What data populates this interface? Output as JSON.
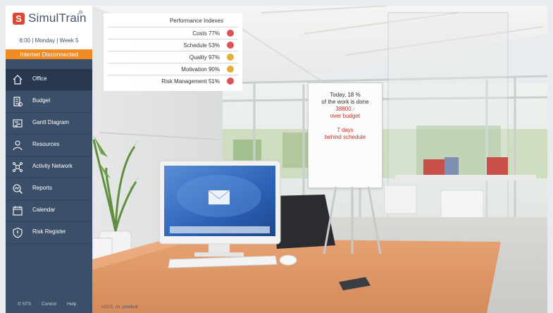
{
  "brand": {
    "logo_letter": "S",
    "name": "SimulTrain",
    "reg": "®",
    "accent": "#d94735"
  },
  "status": {
    "time_line": "8:00  |  Monday  |  Week 5",
    "network": "Internet Disconnected",
    "network_color": "#f08a23"
  },
  "nav": [
    {
      "label": "Office",
      "icon": "office-icon",
      "active": true
    },
    {
      "label": "Budget",
      "icon": "budget-icon",
      "active": false
    },
    {
      "label": "Gantt Diagram",
      "icon": "gantt-icon",
      "active": false
    },
    {
      "label": "Resources",
      "icon": "resources-icon",
      "active": false
    },
    {
      "label": "Activity Network",
      "icon": "activity-network-icon",
      "active": false
    },
    {
      "label": "Reports",
      "icon": "reports-icon",
      "active": false
    },
    {
      "label": "Calendar",
      "icon": "calendar-icon",
      "active": false
    },
    {
      "label": "Risk Register",
      "icon": "risk-register-icon",
      "active": false
    }
  ],
  "footer": {
    "copyright": "© STS",
    "control": "Control",
    "help": "Help",
    "version": "v12.0, cn. product"
  },
  "performance": {
    "title": "Performance Indexes",
    "rows": [
      {
        "label": "Costs 77%",
        "status_color": "#dc5158"
      },
      {
        "label": "Schedule 53%",
        "status_color": "#dc5158"
      },
      {
        "label": "Quality 97%",
        "status_color": "#e5ae35"
      },
      {
        "label": "Motivation 90%",
        "status_color": "#e5ae35"
      },
      {
        "label": "Risk Management 51%",
        "status_color": "#dc5158"
      }
    ]
  },
  "flipchart": {
    "line1": "Today, 18 %",
    "line2": "of the work is done",
    "line3": "38800.-",
    "line4": "over budget",
    "line5": "7 days",
    "line6": "behind schedule",
    "alert_color": "#c0332b"
  }
}
